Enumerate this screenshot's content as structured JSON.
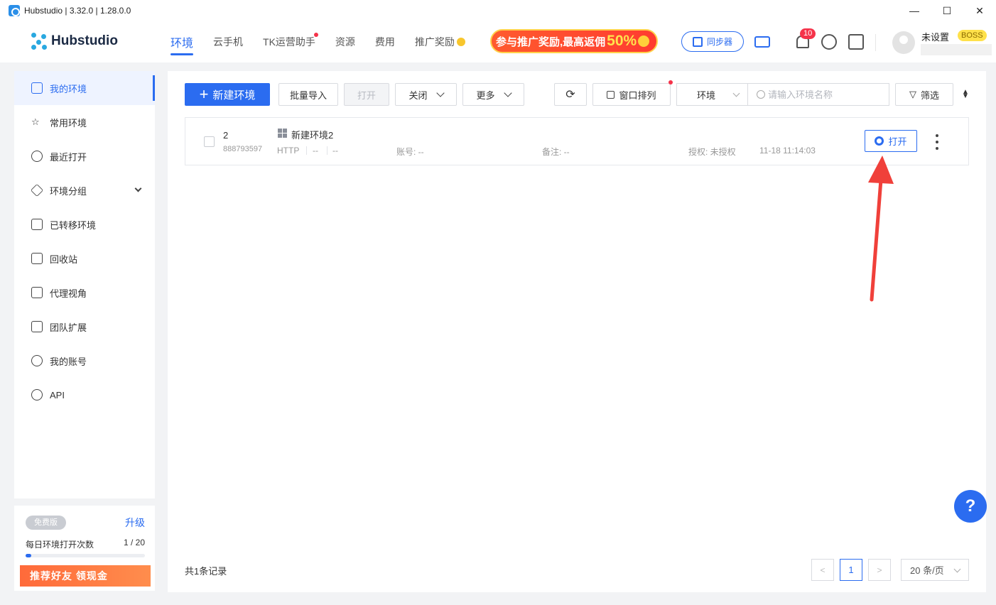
{
  "window": {
    "title": "Hubstudio | 3.32.0 | 1.28.0.0",
    "controls": [
      "—",
      "☐",
      "✕"
    ]
  },
  "header": {
    "logo_text": "Hubstudio",
    "nav": [
      {
        "label": "环境",
        "active": true
      },
      {
        "label": "云手机"
      },
      {
        "label": "TK运营助手",
        "dot": true
      },
      {
        "label": "资源"
      },
      {
        "label": "费用"
      },
      {
        "label": "推广奖励",
        "coin": true
      }
    ],
    "promo_text": "参与推广奖励,最高返佣",
    "promo_big": "50%",
    "sync_label": "同步器",
    "notification_count": "10",
    "user_name": "未设置",
    "user_badge": "BOSS"
  },
  "sidebar": {
    "items": [
      {
        "label": "我的环境",
        "icon": "monitor-icon",
        "active": true
      },
      {
        "label": "常用环境",
        "icon": "star-icon"
      },
      {
        "label": "最近打开",
        "icon": "clock-icon"
      },
      {
        "label": "环境分组",
        "icon": "layers-icon",
        "expandable": true
      },
      {
        "label": "已转移环境",
        "icon": "transfer-icon"
      },
      {
        "label": "回收站",
        "icon": "trash-icon"
      },
      {
        "label": "代理视角",
        "icon": "proxy-icon"
      },
      {
        "label": "团队扩展",
        "icon": "cube-icon"
      },
      {
        "label": "我的账号",
        "icon": "user-icon"
      },
      {
        "label": "API",
        "icon": "api-icon"
      }
    ],
    "plan": {
      "tag": "免费版",
      "upgrade": "升级",
      "label": "每日环境打开次数",
      "count": "1 / 20",
      "progress": 0.05,
      "refer": "推荐好友 领现金"
    }
  },
  "toolbar": {
    "new_env": "新建环境",
    "batch_import": "批量导入",
    "open": "打开",
    "close": "关闭",
    "more": "更多",
    "window_arrange": "窗口排列",
    "search_scope": "环境",
    "search_placeholder": "请输入环境名称",
    "filter": "筛选"
  },
  "table": {
    "rows": [
      {
        "number": "2",
        "id": "888793597",
        "name": "新建环境2",
        "proxy_type": "HTTP",
        "ip": "--",
        "region": "--",
        "account": "账号: --",
        "note": "备注: --",
        "auth": "授权: 未授权",
        "time": "11-18 11:14:03",
        "open_label": "打开"
      }
    ]
  },
  "footer": {
    "total": "共1条记录",
    "prev": "<",
    "current_page": "1",
    "next": ">",
    "page_size": "20 条/页"
  },
  "help": "?",
  "colors": {
    "accent": "#2b6cf0",
    "danger": "#f5334a",
    "arrow": "#f0403a"
  }
}
